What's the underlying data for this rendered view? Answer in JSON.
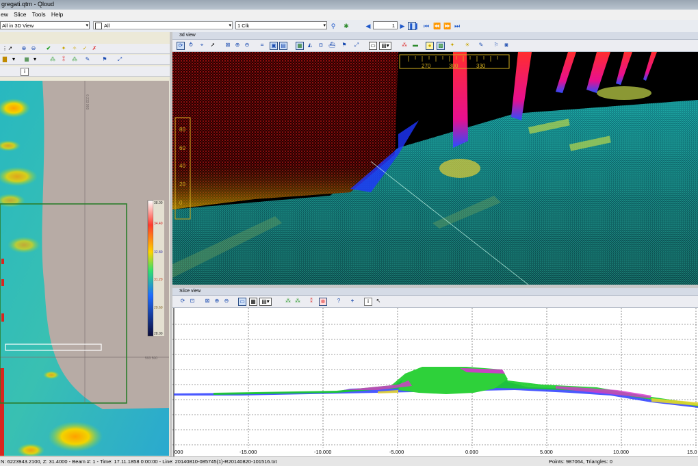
{
  "title": "gregati.qtm - Qloud",
  "menu": [
    "ew",
    "Slice",
    "Tools",
    "Help"
  ],
  "toolbar": {
    "view_mode": "All in 3D View",
    "filter_checkbox_label": "All",
    "clock_select": "1 Clk",
    "frame": "1"
  },
  "panes": {
    "view3d": "3d view",
    "slice_view": "Slice view"
  },
  "compass": {
    "ticks": [
      "270",
      "300",
      "330"
    ]
  },
  "pitch_scale": {
    "ticks": [
      "80",
      "60",
      "40",
      "20",
      "0"
    ]
  },
  "colorbar": {
    "labels": [
      "38.00",
      "34.40",
      "32.80",
      "31.20",
      "29.60",
      "28.00"
    ]
  },
  "map_labels": {
    "top_coord": "6 233 900",
    "right_coord": "593 500"
  },
  "slice_axis": [
    "000",
    "-15.000",
    "-10.000",
    "-5.000",
    "0.000",
    "5.000",
    "10.000",
    "15.0"
  ],
  "status": {
    "left": "N: 6223943.2100, Z: 31.4000 - Beam #: 1 - Time: 17.11.1858 0:00:00 - Line: 20140810-085745(1)-R20140820-101516.txt",
    "right": "Points: 987064, Triangles: 0"
  }
}
